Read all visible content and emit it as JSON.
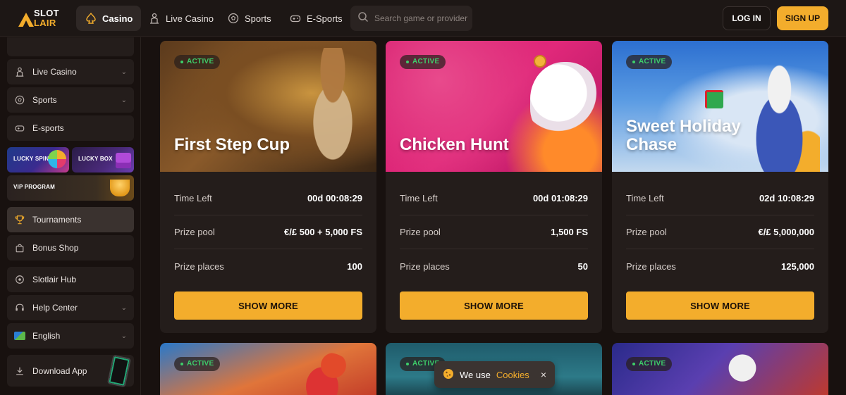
{
  "header": {
    "logo_top": "SLOT",
    "logo_bottom": "LAIR",
    "nav": [
      {
        "label": "Casino",
        "icon": "spade-icon",
        "active": true
      },
      {
        "label": "Live Casino",
        "icon": "dealer-icon",
        "active": false
      },
      {
        "label": "Sports",
        "icon": "soccer-ball-icon",
        "active": false
      },
      {
        "label": "E-Sports",
        "icon": "gamepad-icon",
        "active": false
      }
    ],
    "search_placeholder": "Search game or provider",
    "login_label": "LOG IN",
    "signup_label": "SIGN UP"
  },
  "sidebar": {
    "items": [
      {
        "label": "Live Casino",
        "icon": "dealer-icon",
        "has_chevron": true
      },
      {
        "label": "Sports",
        "icon": "soccer-ball-icon",
        "has_chevron": true
      },
      {
        "label": "E-sports",
        "icon": "gamepad-icon",
        "has_chevron": false
      },
      {
        "label": "Tournaments",
        "icon": "trophy-icon",
        "has_chevron": false,
        "active": true
      },
      {
        "label": "Bonus Shop",
        "icon": "shopping-bag-icon",
        "has_chevron": false
      },
      {
        "label": "Slotlair Hub",
        "icon": "hub-icon",
        "has_chevron": false
      },
      {
        "label": "Help Center",
        "icon": "headset-icon",
        "has_chevron": true
      },
      {
        "label": "English",
        "icon": "flag-icon",
        "has_chevron": true
      },
      {
        "label": "Download App",
        "icon": "download-icon",
        "has_chevron": false
      }
    ],
    "promos": {
      "lucky_spin": "LUCKY SPIN",
      "lucky_box": "LUCKY BOX",
      "vip_program": "VIP PROGRAM"
    }
  },
  "tournaments": [
    {
      "status": "ACTIVE",
      "title": "First Step Cup",
      "time_left_label": "Time Left",
      "time_left": "00d 00:08:29",
      "prize_pool_label": "Prize pool",
      "prize_pool": "€/£ 500 + 5,000 FS",
      "prize_places_label": "Prize places",
      "prize_places": "100",
      "button": "SHOW MORE"
    },
    {
      "status": "ACTIVE",
      "title": "Chicken Hunt",
      "time_left_label": "Time Left",
      "time_left": "00d 01:08:29",
      "prize_pool_label": "Prize pool",
      "prize_pool": "1,500 FS",
      "prize_places_label": "Prize places",
      "prize_places": "50",
      "button": "SHOW MORE"
    },
    {
      "status": "ACTIVE",
      "title": "Sweet Holiday Chase",
      "time_left_label": "Time Left",
      "time_left": "02d 10:08:29",
      "prize_pool_label": "Prize pool",
      "prize_pool": "€/£ 5,000,000",
      "prize_places_label": "Prize places",
      "prize_places": "125,000",
      "button": "SHOW MORE"
    }
  ],
  "second_row": [
    {
      "status": "ACTIVE"
    },
    {
      "status": "ACTIVE"
    },
    {
      "status": "ACTIVE"
    }
  ],
  "cookie_toast": {
    "text": "We use",
    "link": "Cookies",
    "close": "×"
  },
  "colors": {
    "accent": "#f3ad2c",
    "active_green": "#3ecf6a",
    "background": "#18110f",
    "card": "#241d1b"
  }
}
